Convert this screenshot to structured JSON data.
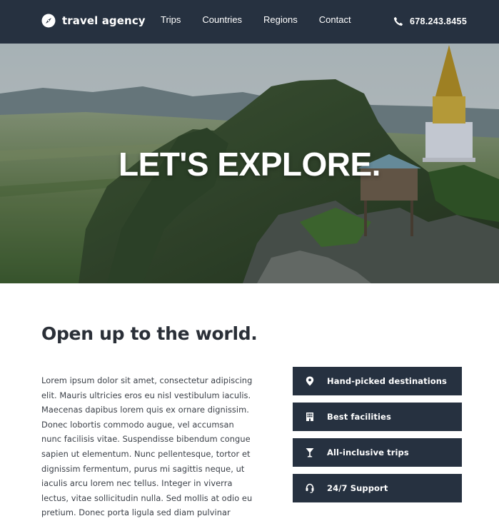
{
  "header": {
    "brand": "travel agency",
    "brand_icon": "compass-icon",
    "nav": [
      "Trips",
      "Countries",
      "Regions",
      "Contact"
    ],
    "phone_icon": "phone-icon",
    "phone": "678.243.8455"
  },
  "hero": {
    "title": "LET'S EXPLORE."
  },
  "main": {
    "heading": "Open up to the world.",
    "body": "Lorem ipsum dolor sit amet, consectetur adipiscing elit. Mauris ultricies eros eu nisl vestibulum iaculis. Maecenas dapibus lorem quis ex ornare dignissim. Donec lobortis commodo augue, vel accumsan nunc facilisis vitae. Suspendisse bibendum congue sapien ut elementum. Nunc pellentesque, tortor et dignissim fermentum, purus mi sagittis neque, ut iaculis arcu lorem nec tellus. Integer in viverra lectus, vitae sollicitudin nulla. Sed mollis at odio eu pretium. Donec porta ligula sed diam pulvinar",
    "features": [
      {
        "icon": "map-marker-icon",
        "label": "Hand-picked destinations"
      },
      {
        "icon": "building-icon",
        "label": "Best facilities"
      },
      {
        "icon": "cocktail-icon",
        "label": "All-inclusive trips"
      },
      {
        "icon": "headset-icon",
        "label": "24/7 Support"
      }
    ]
  },
  "colors": {
    "navy": "#263140",
    "white": "#ffffff",
    "text": "#2a2f37"
  }
}
